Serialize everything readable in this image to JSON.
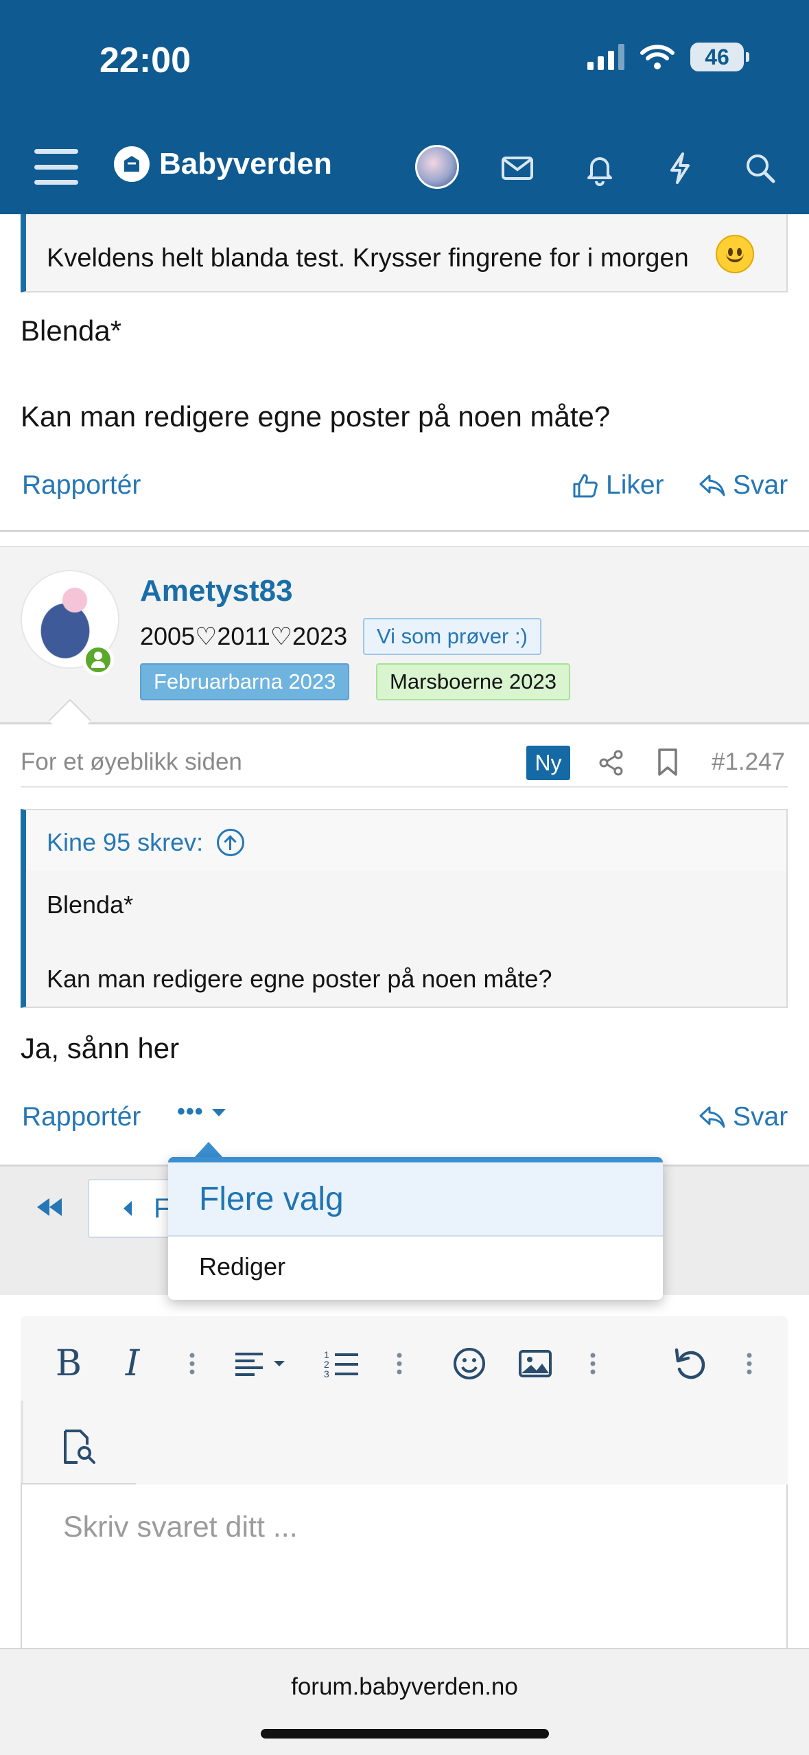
{
  "status_bar": {
    "time": "22:00",
    "battery": "46"
  },
  "header": {
    "brand": "Babyverden"
  },
  "previous_post": {
    "quote_text": "Kveldens helt blanda test. Krysser fingrene for i morgen",
    "lines": [
      "Blenda*",
      "Kan man redigere egne poster på noen måte?"
    ],
    "actions": {
      "report": "Rapportér",
      "like": "Liker",
      "reply": "Svar"
    }
  },
  "post": {
    "username": "Ametyst83",
    "user_title": "2005♡2011♡2023",
    "badges": [
      "Vi som prøver :)",
      "Februarbarna 2023",
      "Marsboerne 2023"
    ],
    "time": "For et øyeblikk siden",
    "new_badge": "Ny",
    "number": "#1.247",
    "quote": {
      "author": "Kine 95 skrev:",
      "lines": [
        "Blenda*",
        "Kan man redigere egne poster på noen måte?"
      ]
    },
    "text": "Ja, sånn her",
    "actions": {
      "report": "Rapportér",
      "more": "•••",
      "reply": "Svar"
    }
  },
  "menu": {
    "title": "Flere valg",
    "items": [
      "Rediger"
    ]
  },
  "pager": {
    "prev_label": "F"
  },
  "editor": {
    "placeholder": "Skriv svaret ditt ..."
  },
  "browser": {
    "url": "forum.babyverden.no"
  },
  "colors": {
    "header_bg": "#0f5a91",
    "link": "#2577b5",
    "accent": "#3b8fd0",
    "online": "#5ba82b"
  }
}
